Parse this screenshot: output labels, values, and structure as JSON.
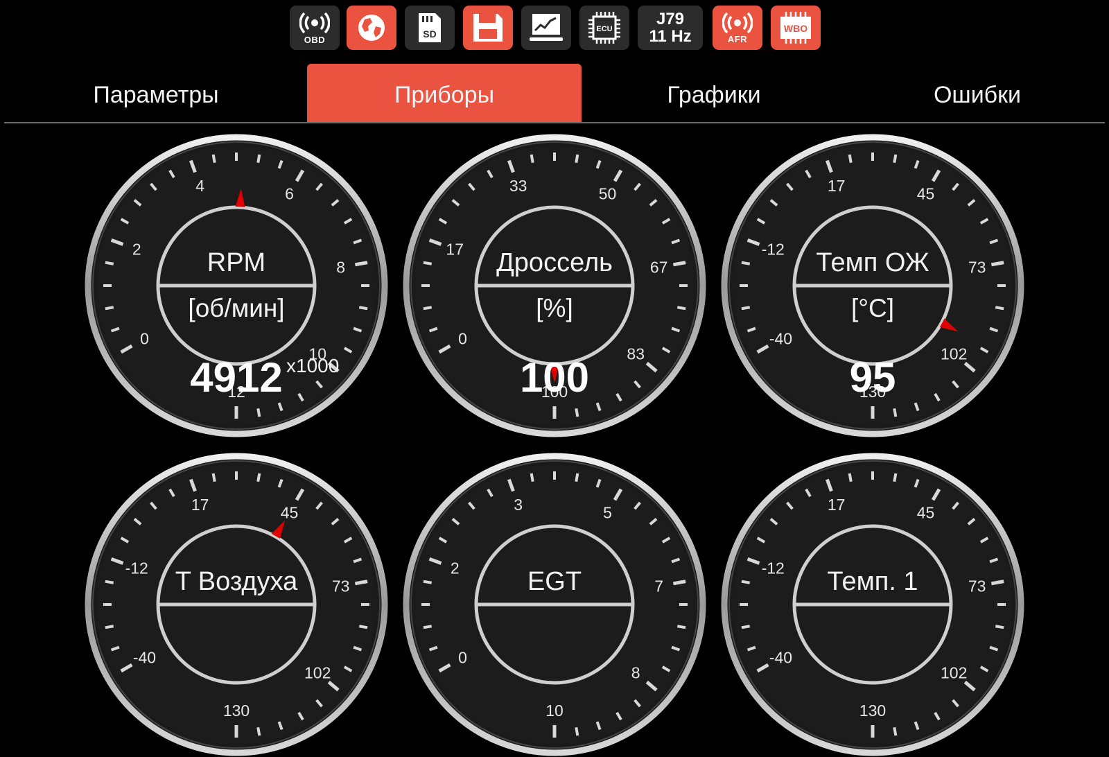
{
  "toolbar": {
    "buttons": [
      {
        "icon": "obd-icon",
        "caption": "OBD",
        "active": false
      },
      {
        "icon": "globe-icon",
        "caption": "",
        "active": true
      },
      {
        "icon": "sd-card-icon",
        "caption": "SD",
        "active": false
      },
      {
        "icon": "save-icon",
        "caption": "",
        "active": true
      },
      {
        "icon": "chart-icon",
        "caption": "",
        "active": false
      },
      {
        "icon": "ecu-chip-icon",
        "caption": "ECU",
        "active": false
      },
      {
        "icon": "protocol-text",
        "line1": "J79",
        "line2": "11 Hz",
        "active": false
      },
      {
        "icon": "afr-icon",
        "caption": "AFR",
        "active": true
      },
      {
        "icon": "wbo-icon",
        "caption": "WBO",
        "active": true
      }
    ]
  },
  "colors": {
    "accent": "#e9533f",
    "needle": "#e00000",
    "inactive_button": "#2c2c2c"
  },
  "tabs": [
    {
      "label": "Параметры",
      "active": false
    },
    {
      "label": "Приборы",
      "active": true
    },
    {
      "label": "Графики",
      "active": false
    },
    {
      "label": "Ошибки",
      "active": false
    }
  ],
  "gauges": [
    {
      "label": "RPM",
      "unit": "[об/мин]",
      "value": "4912",
      "multiplier": "x1000",
      "ticks": [
        "0",
        "2",
        "4",
        "6",
        "8",
        "10",
        "12"
      ],
      "min": 0,
      "max": 12,
      "needle_value": 4.912
    },
    {
      "label": "Дроссель",
      "unit": "[%]",
      "value": "100",
      "multiplier": "",
      "ticks": [
        "0",
        "17",
        "33",
        "50",
        "67",
        "83",
        "100"
      ],
      "min": 0,
      "max": 100,
      "needle_value": 100
    },
    {
      "label": "Темп ОЖ",
      "unit": "[°C]",
      "value": "95",
      "multiplier": "",
      "ticks": [
        "-40",
        "-12",
        "17",
        "45",
        "73",
        "102",
        "130"
      ],
      "min": -40,
      "max": 130,
      "needle_value": 95
    },
    {
      "label": "T Воздуха",
      "unit": "",
      "value": "",
      "multiplier": "",
      "ticks": [
        "-40",
        "-12",
        "17",
        "45",
        "73",
        "102",
        "130"
      ],
      "min": -40,
      "max": 130,
      "needle_value": 45
    },
    {
      "label": "EGT",
      "unit": "",
      "value": "",
      "multiplier": "",
      "ticks": [
        "0",
        "2",
        "3",
        "5",
        "7",
        "8",
        "10"
      ],
      "min": 0,
      "max": 10,
      "needle_value": null
    },
    {
      "label": "Темп. 1",
      "unit": "",
      "value": "",
      "multiplier": "",
      "ticks": [
        "-40",
        "-12",
        "17",
        "45",
        "73",
        "102",
        "130"
      ],
      "min": -40,
      "max": 130,
      "needle_value": null
    }
  ]
}
